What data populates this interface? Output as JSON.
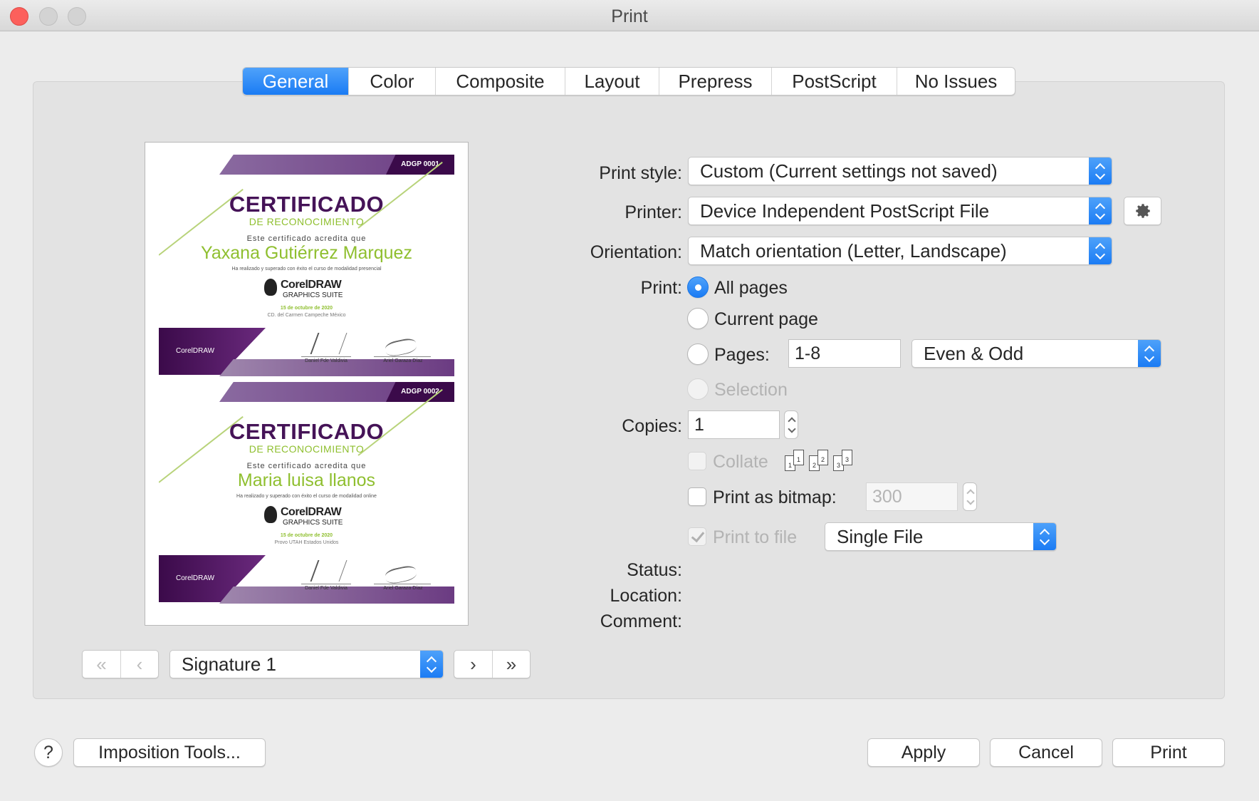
{
  "window": {
    "title": "Print"
  },
  "tabs": [
    {
      "label": "General",
      "active": true
    },
    {
      "label": "Color"
    },
    {
      "label": "Composite"
    },
    {
      "label": "Layout"
    },
    {
      "label": "Prepress"
    },
    {
      "label": "PostScript"
    },
    {
      "label": "No Issues"
    }
  ],
  "preview": {
    "certs": [
      {
        "code": "ADGP  0001",
        "title": "CERTIFICADO",
        "subtitle": "DE RECONOCIMIENTO",
        "line1": "Este certificado acredita que",
        "name": "Yaxana Gutiérrez Marquez",
        "line2": "Ha realizado y superado con éxito el curso de modalidad presencial",
        "logo_main": "CorelDRAW",
        "logo_sub": "GRAPHICS SUITE",
        "date": "15 de octubre de 2020",
        "place": "CD. del Carmen Campeche México",
        "band_logo": "CorelDRAW",
        "signer1": "Daniel Fde Valdivia",
        "signer2": "Ariel Garaza Díaz"
      },
      {
        "code": "ADGP  0002",
        "title": "CERTIFICADO",
        "subtitle": "DE RECONOCIMIENTO",
        "line1": "Este certificado acredita que",
        "name": "Maria luisa llanos",
        "line2": "Ha realizado y superado con éxito el curso de modalidad online",
        "logo_main": "CorelDRAW",
        "logo_sub": "GRAPHICS SUITE",
        "date": "15 de octubre de 2020",
        "place": "Provo UTAH Estados Unidos",
        "band_logo": "CorelDRAW",
        "signer1": "Daniel Fde Valdivia",
        "signer2": "Ariel Garaza Díaz"
      }
    ],
    "nav": {
      "first": "«",
      "prev": "‹",
      "next": "›",
      "last": "»",
      "signature": "Signature 1"
    }
  },
  "form": {
    "print_style_label": "Print style:",
    "print_style_value": "Custom (Current settings not saved)",
    "printer_label": "Printer:",
    "printer_value": "Device Independent PostScript File",
    "orientation_label": "Orientation:",
    "orientation_value": "Match orientation (Letter, Landscape)",
    "print_label": "Print:",
    "all_pages": "All pages",
    "current_page": "Current page",
    "pages": "Pages:",
    "pages_value": "1-8",
    "even_odd": "Even & Odd",
    "selection": "Selection",
    "copies_label": "Copies:",
    "copies_value": "1",
    "collate": "Collate",
    "collate_pages": [
      "1",
      "1",
      "2",
      "2",
      "3",
      "3"
    ],
    "print_as_bitmap": "Print as bitmap:",
    "bitmap_value": "300",
    "print_to_file": "Print to file",
    "file_mode": "Single File",
    "status_label": "Status:",
    "location_label": "Location:",
    "comment_label": "Comment:"
  },
  "footer": {
    "help": "?",
    "imposition": "Imposition Tools...",
    "apply": "Apply",
    "cancel": "Cancel",
    "print": "Print"
  },
  "colors": {
    "accent": "#1a7bf4",
    "close": "#fc605c",
    "cert_purple": "#451357",
    "cert_green": "#8fbf2f"
  }
}
